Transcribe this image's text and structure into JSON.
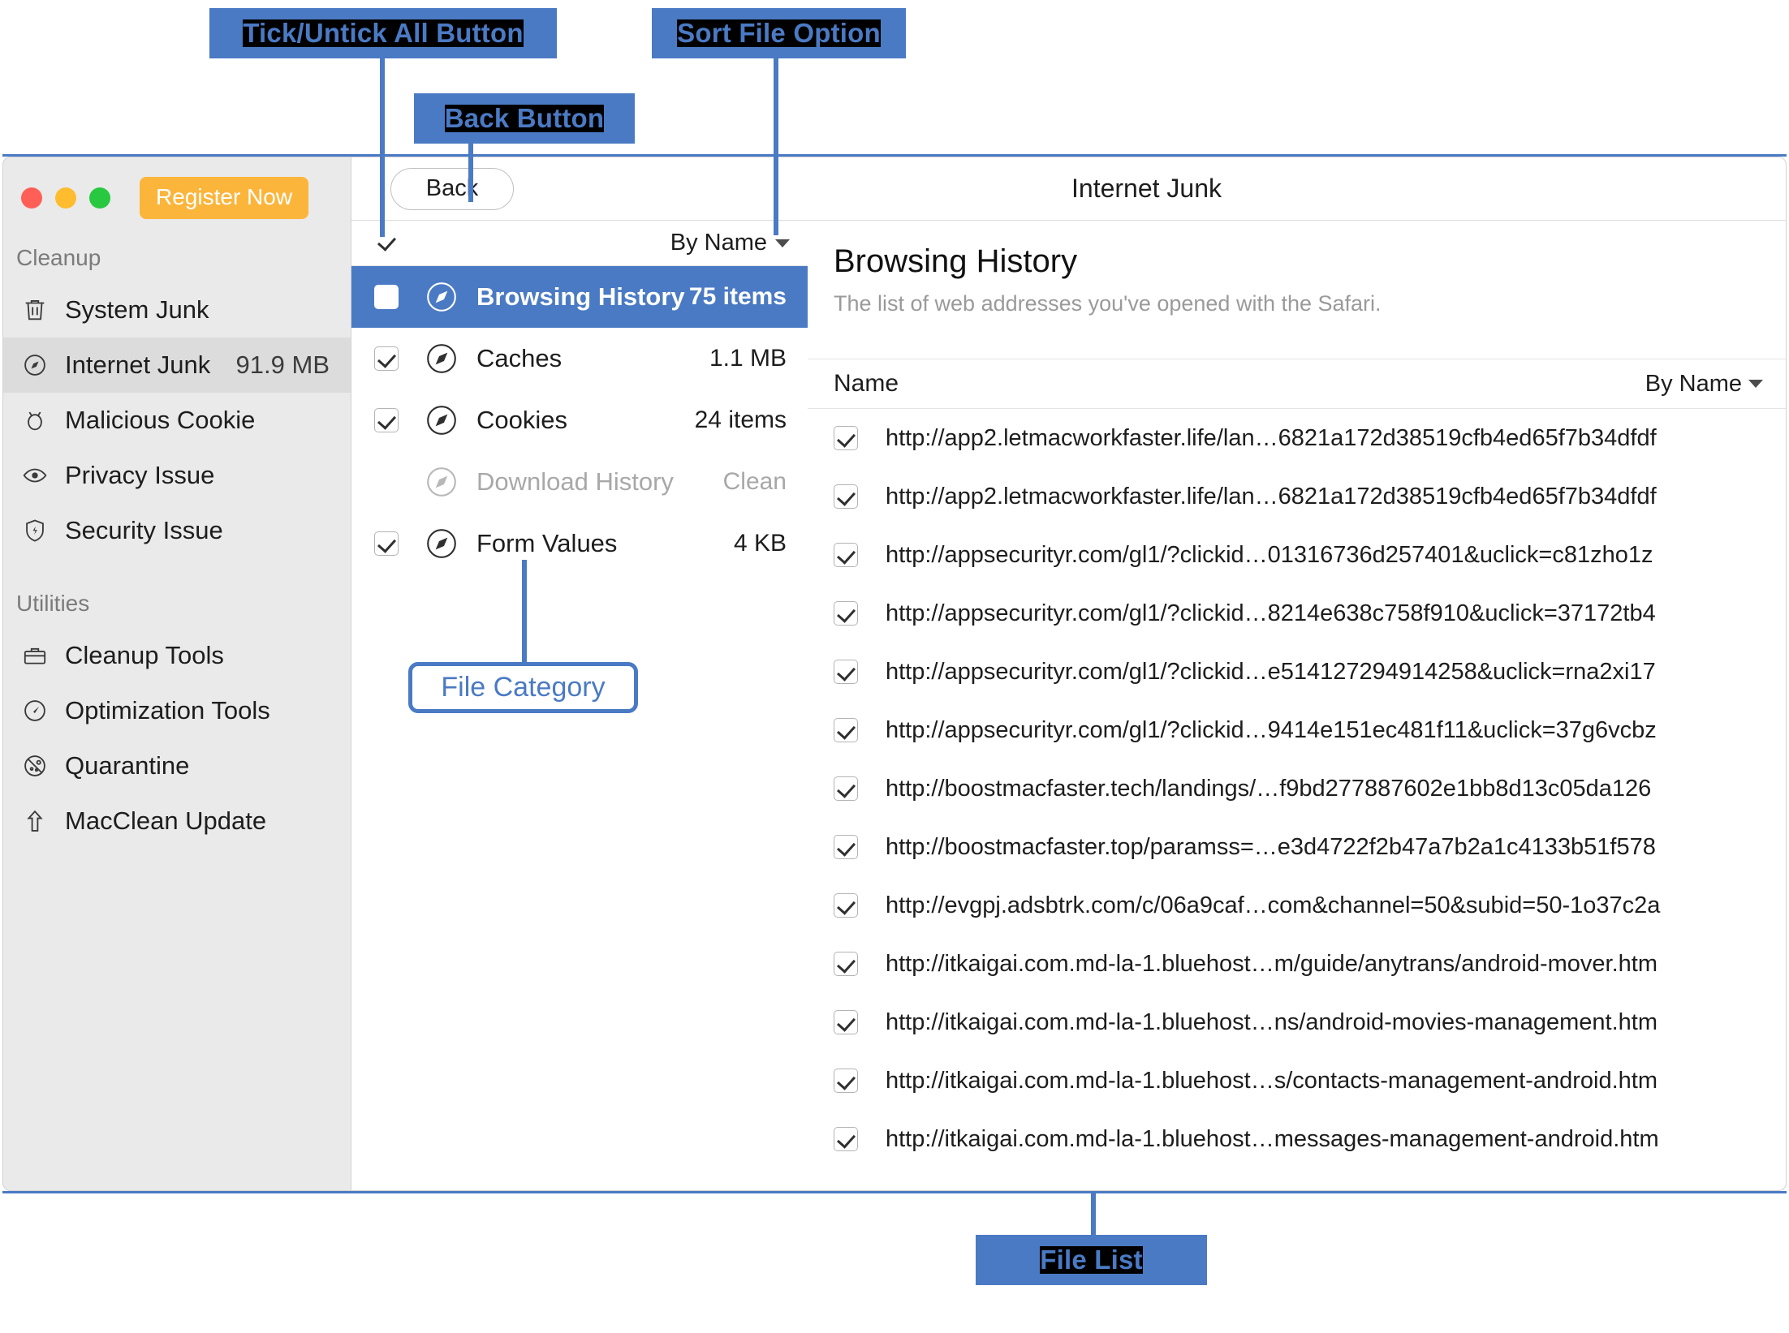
{
  "annotations": [
    {
      "id": "tick-untick-all",
      "label": "Tick/Untick All Button"
    },
    {
      "id": "sort-file-option",
      "label": "Sort File Option"
    },
    {
      "id": "back-button",
      "label": "Back Button"
    },
    {
      "id": "file-category",
      "label": "File Category"
    },
    {
      "id": "file-list",
      "label": "File List"
    }
  ],
  "colors": {
    "annotation_blue": "#4a7ac4",
    "selection_blue": "#4a7ac4",
    "register_orange": "#fcb53b",
    "sidebar_bg": "#eaeaea",
    "traffic_red": "#ff5f57",
    "traffic_yellow": "#febc2e",
    "traffic_green": "#28c840"
  },
  "sidebar": {
    "register_button": "Register Now",
    "groups": [
      {
        "title": "Cleanup",
        "items": [
          {
            "label": "System Junk",
            "size": "",
            "icon": "trash-icon",
            "active": false
          },
          {
            "label": "Internet Junk",
            "size": "91.9 MB",
            "icon": "compass-icon",
            "active": true
          },
          {
            "label": "Malicious Cookie",
            "size": "",
            "icon": "bug-icon",
            "active": false
          },
          {
            "label": "Privacy Issue",
            "size": "",
            "icon": "eye-icon",
            "active": false
          },
          {
            "label": "Security Issue",
            "size": "",
            "icon": "shield-icon",
            "active": false
          }
        ]
      },
      {
        "title": "Utilities",
        "items": [
          {
            "label": "Cleanup Tools",
            "size": "",
            "icon": "toolbox-icon",
            "active": false
          },
          {
            "label": "Optimization Tools",
            "size": "",
            "icon": "gauge-icon",
            "active": false
          },
          {
            "label": "Quarantine",
            "size": "",
            "icon": "quarantine-icon",
            "active": false
          },
          {
            "label": "MacClean Update",
            "size": "",
            "icon": "upload-arrow-icon",
            "active": false
          }
        ]
      }
    ]
  },
  "middle": {
    "back_label": "Back",
    "select_all_checked": true,
    "sort_label": "By Name",
    "categories": [
      {
        "name": "Browsing History",
        "size": "75 items",
        "checked": true,
        "selected": true,
        "disabled": false
      },
      {
        "name": "Caches",
        "size": "1.1 MB",
        "checked": true,
        "selected": false,
        "disabled": false
      },
      {
        "name": "Cookies",
        "size": "24 items",
        "checked": true,
        "selected": false,
        "disabled": false
      },
      {
        "name": "Download History",
        "size": "Clean",
        "checked": false,
        "selected": false,
        "disabled": true
      },
      {
        "name": "Form Values",
        "size": "4 KB",
        "checked": true,
        "selected": false,
        "disabled": false
      }
    ]
  },
  "right": {
    "window_title": "Internet Junk",
    "detail_title": "Browsing History",
    "detail_subtitle": "The list of web addresses you've opened with the Safari.",
    "column_name": "Name",
    "sort_label": "By Name",
    "files": [
      {
        "url": "http://app2.letmacworkfaster.life/lan…6821a172d38519cfb4ed65f7b34dfdf",
        "checked": true
      },
      {
        "url": "http://app2.letmacworkfaster.life/lan…6821a172d38519cfb4ed65f7b34dfdf",
        "checked": true
      },
      {
        "url": "http://appsecurityr.com/gl1/?clickid…01316736d257401&uclick=c81zho1z",
        "checked": true
      },
      {
        "url": "http://appsecurityr.com/gl1/?clickid…8214e638c758f910&uclick=37172tb4",
        "checked": true
      },
      {
        "url": "http://appsecurityr.com/gl1/?clickid…e514127294914258&uclick=rna2xi17",
        "checked": true
      },
      {
        "url": "http://appsecurityr.com/gl1/?clickid…9414e151ec481f11&uclick=37g6vcbz",
        "checked": true
      },
      {
        "url": "http://boostmacfaster.tech/landings/…f9bd277887602e1bb8d13c05da126",
        "checked": true
      },
      {
        "url": "http://boostmacfaster.top/paramss=…e3d4722f2b47a7b2a1c4133b51f578",
        "checked": true
      },
      {
        "url": "http://evgpj.adsbtrk.com/c/06a9caf…com&channel=50&subid=50-1o37c2a",
        "checked": true
      },
      {
        "url": "http://itkaigai.com.md-la-1.bluehost…m/guide/anytrans/android-mover.htm",
        "checked": true
      },
      {
        "url": "http://itkaigai.com.md-la-1.bluehost…ns/android-movies-management.htm",
        "checked": true
      },
      {
        "url": "http://itkaigai.com.md-la-1.bluehost…s/contacts-management-android.htm",
        "checked": true
      },
      {
        "url": "http://itkaigai.com.md-la-1.bluehost…messages-management-android.htm",
        "checked": true
      }
    ]
  }
}
